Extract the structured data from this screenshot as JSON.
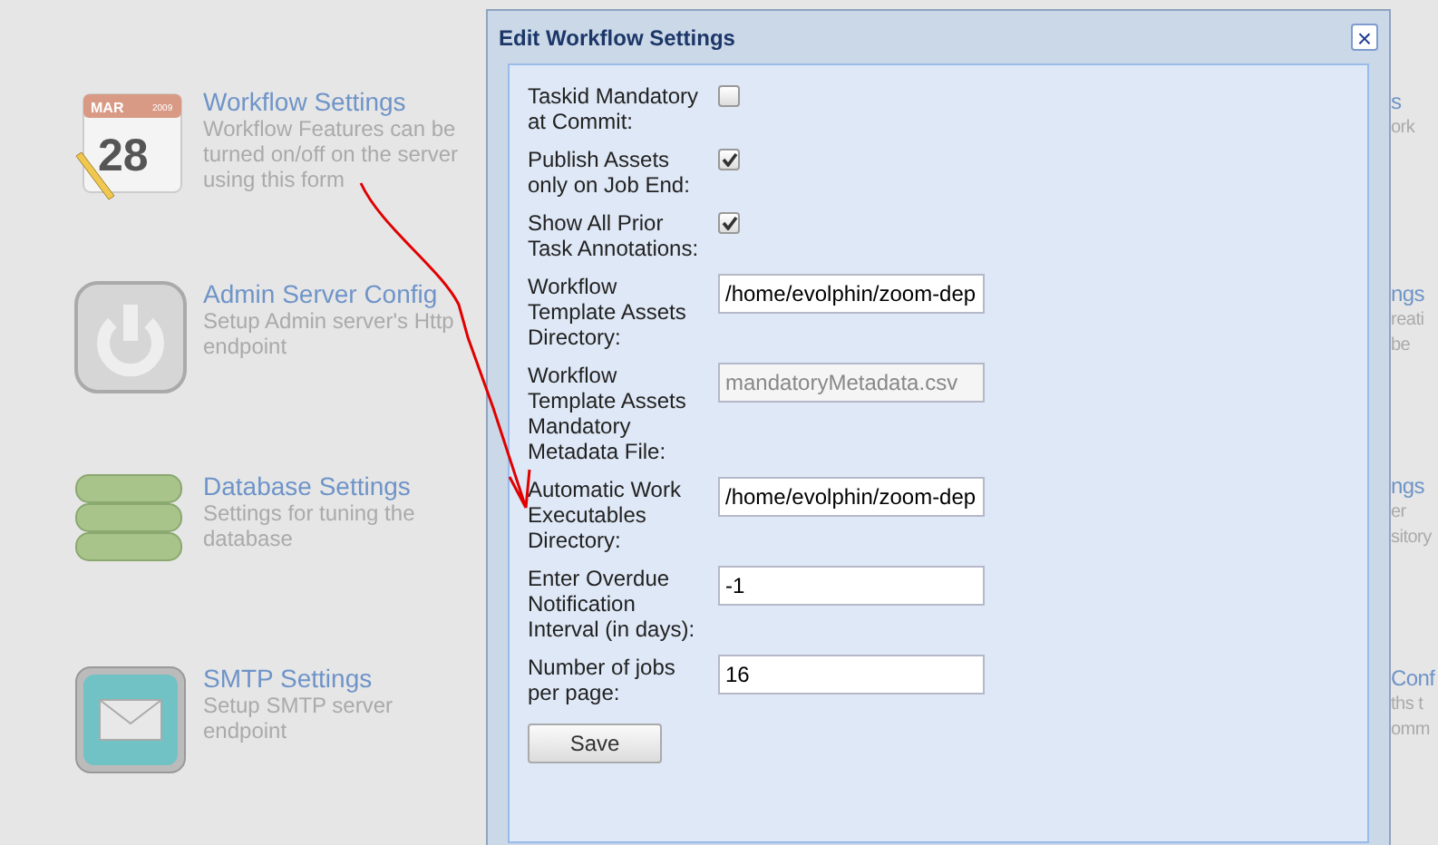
{
  "settings_items": [
    {
      "kind": "calendar",
      "calendar_month": "MAR",
      "calendar_year": "2009",
      "calendar_day": "28",
      "title": "Workflow Settings",
      "description": [
        "Workflow Features can be",
        "turned on/off on the server",
        "using this form"
      ]
    },
    {
      "kind": "power",
      "title": "Admin Server Config",
      "description": [
        "Setup Admin server's Http",
        "endpoint"
      ]
    },
    {
      "kind": "database",
      "title": "Database Settings",
      "description": [
        "Settings for tuning the",
        "database"
      ]
    },
    {
      "kind": "mail",
      "title": "SMTP Settings",
      "description": [
        "Setup SMTP server",
        "endpoint"
      ]
    }
  ],
  "right_items": [
    {
      "title": "s",
      "description": [
        "ork"
      ]
    },
    {
      "title": "ngs",
      "description": [
        "reati",
        "be"
      ]
    },
    {
      "title": "ngs",
      "description": [
        "er",
        "sitory"
      ]
    },
    {
      "title": "Conf",
      "description": [
        "ths t",
        "omm"
      ]
    }
  ],
  "dialog": {
    "title": "Edit Workflow Settings",
    "close_label": "×",
    "fields": [
      {
        "kind": "checkbox",
        "label": [
          "Taskid Mandatory",
          "at Commit:"
        ],
        "checked": false
      },
      {
        "kind": "checkbox",
        "label": [
          "Publish Assets",
          "only on Job End:"
        ],
        "checked": true
      },
      {
        "kind": "checkbox",
        "label": [
          "Show All Prior",
          "Task Annotations:"
        ],
        "checked": true
      },
      {
        "kind": "text",
        "label": [
          "Workflow",
          "Template Assets",
          "Directory:"
        ],
        "value": "/home/evolphin/zoom-dep",
        "disabled": false
      },
      {
        "kind": "text",
        "label": [
          "Workflow",
          "Template Assets",
          "Mandatory",
          "Metadata File:"
        ],
        "value": "mandatoryMetadata.csv",
        "disabled": true
      },
      {
        "kind": "text",
        "label": [
          "Automatic Work",
          "Executables",
          "Directory:"
        ],
        "value": "/home/evolphin/zoom-dep",
        "disabled": false
      },
      {
        "kind": "text",
        "label": [
          "Enter Overdue",
          "Notification",
          "Interval (in days):"
        ],
        "value": "-1",
        "disabled": false
      },
      {
        "kind": "text",
        "label": [
          "Number of jobs",
          "per page:"
        ],
        "value": "16",
        "disabled": false
      }
    ],
    "save_label": "Save"
  }
}
